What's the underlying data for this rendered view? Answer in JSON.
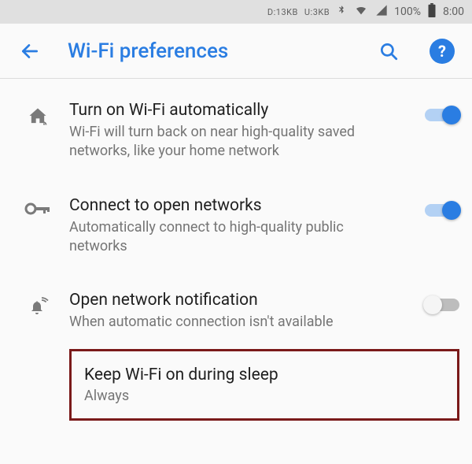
{
  "status_bar": {
    "down": "D:13KB",
    "up": "U:3KB",
    "battery_pct": "100%",
    "time": "8:00"
  },
  "app_bar": {
    "title": "Wi-Fi preferences"
  },
  "items": {
    "auto_on": {
      "title": "Turn on Wi-Fi automatically",
      "desc": "Wi-Fi will turn back on near high-quality saved networks, like your home network",
      "toggle": true
    },
    "open_net": {
      "title": "Connect to open networks",
      "desc": "Automatically connect to high-quality public networks",
      "toggle": true
    },
    "open_notif": {
      "title": "Open network notification",
      "desc": "When automatic connection isn't available",
      "toggle": false
    },
    "sleep": {
      "title": "Keep Wi-Fi on during sleep",
      "value": "Always"
    }
  }
}
